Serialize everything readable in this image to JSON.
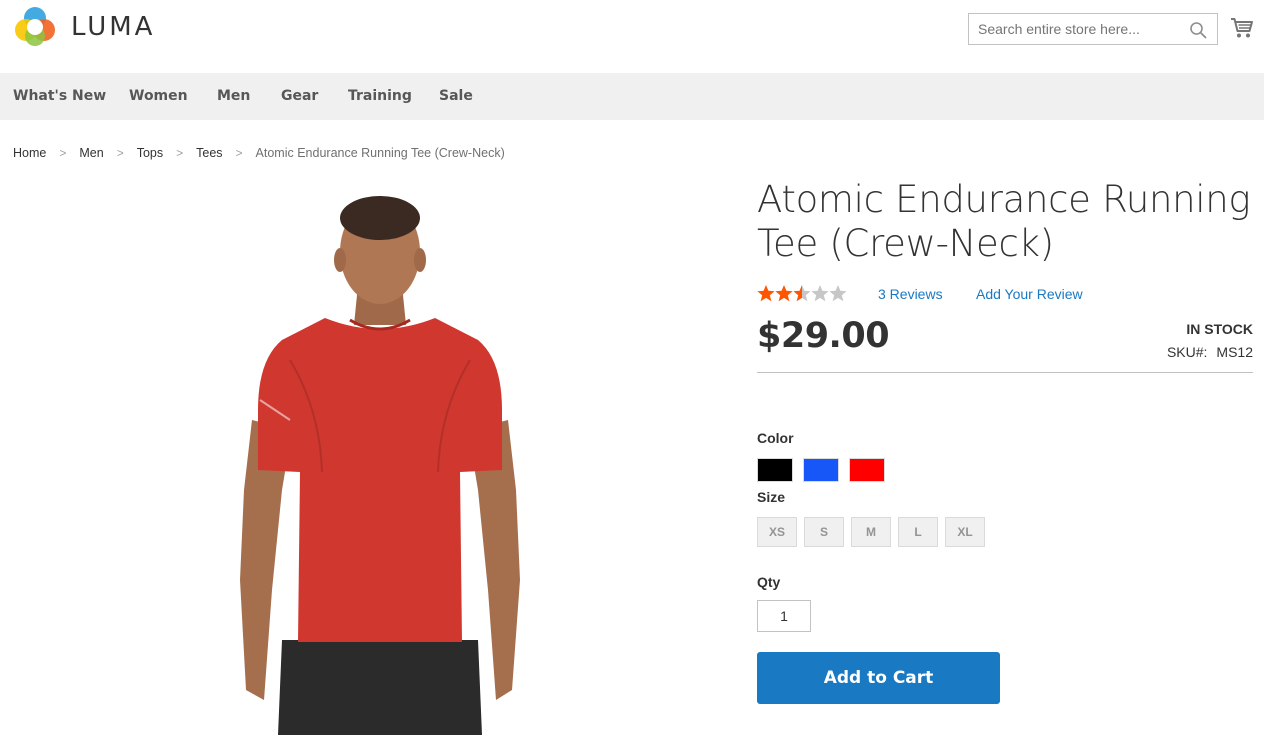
{
  "brand": {
    "name": "LUMA"
  },
  "search": {
    "placeholder": "Search entire store here..."
  },
  "nav": {
    "items": [
      "What's New",
      "Women",
      "Men",
      "Gear",
      "Training",
      "Sale"
    ]
  },
  "breadcrumb": {
    "items": [
      "Home",
      "Men",
      "Tops",
      "Tees"
    ],
    "current": "Atomic Endurance Running Tee (Crew-Neck)",
    "separator": ">"
  },
  "product": {
    "title": "Atomic Endurance Running Tee (Crew-Neck)",
    "rating": {
      "value": 2.5,
      "max": 5
    },
    "reviews_link": "3 Reviews",
    "add_review_link": "Add Your Review",
    "price": "$29.00",
    "stock": "IN STOCK",
    "sku_label": "SKU#:",
    "sku": "MS12",
    "color_label": "Color",
    "colors": [
      {
        "name": "Black",
        "hex": "#000000"
      },
      {
        "name": "Blue",
        "hex": "#1857f7"
      },
      {
        "name": "Red",
        "hex": "#ff0000"
      }
    ],
    "size_label": "Size",
    "sizes": [
      "XS",
      "S",
      "M",
      "L",
      "XL"
    ],
    "qty_label": "Qty",
    "qty_value": "1",
    "add_to_cart": "Add to Cart"
  },
  "icons": {
    "search": "search-icon",
    "cart": "cart-icon",
    "star": "star-icon"
  },
  "colors": {
    "accent": "#1979c3",
    "star_filled": "#ff5501",
    "star_empty": "#c7c7c7",
    "nav_bg": "#f0f0f0"
  }
}
